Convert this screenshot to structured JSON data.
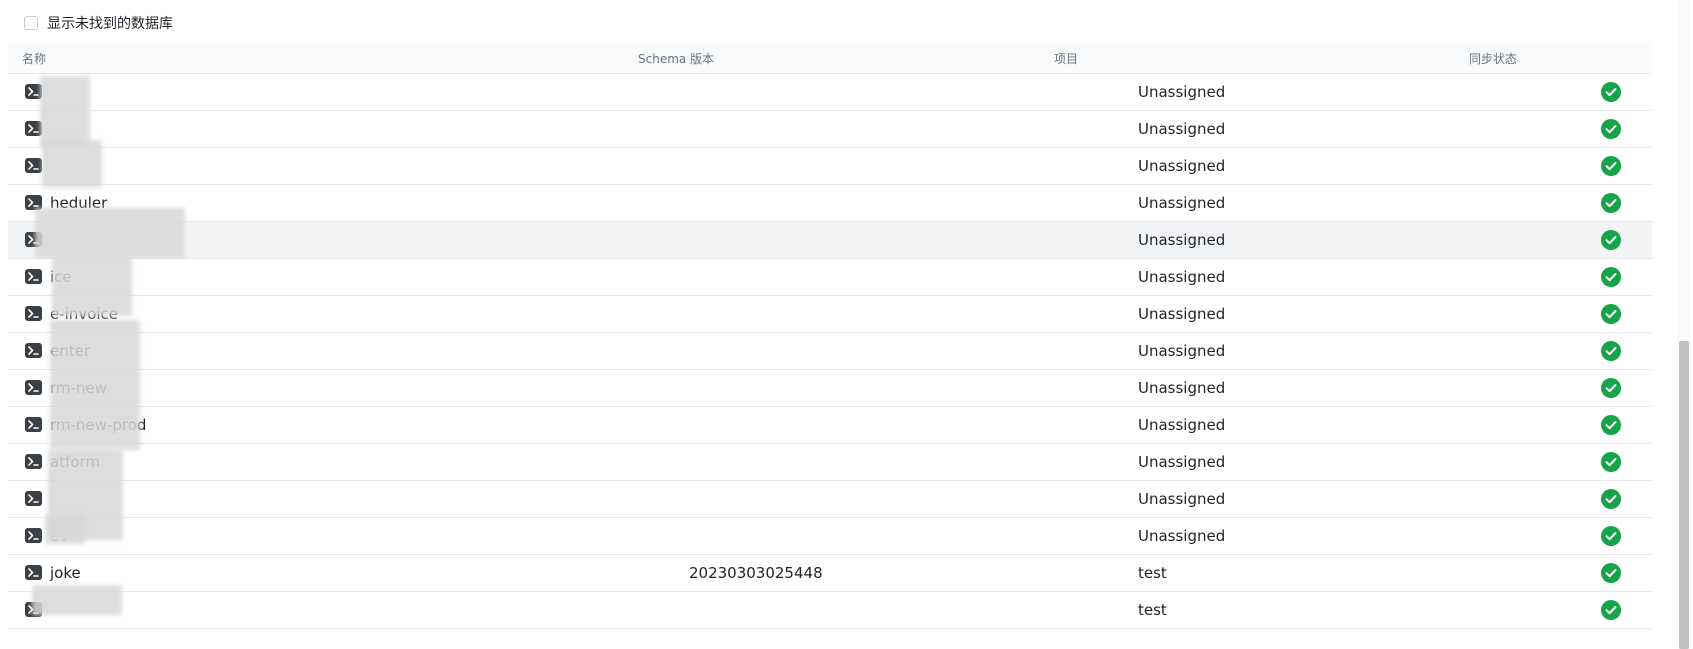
{
  "filter": {
    "show_missing_label": "显示未找到的数据库",
    "checked": false
  },
  "table": {
    "headers": {
      "name": "名称",
      "schema": "Schema 版本",
      "project": "项目",
      "sync": "同步状态"
    },
    "rows": [
      {
        "name": "",
        "schema": "",
        "project": "Unassigned",
        "status": "synced"
      },
      {
        "name": "",
        "schema": "",
        "project": "Unassigned",
        "status": "synced"
      },
      {
        "name": "",
        "schema": "",
        "project": "Unassigned",
        "status": "synced"
      },
      {
        "name": "heduler",
        "schema": "",
        "project": "Unassigned",
        "status": "synced"
      },
      {
        "name": "",
        "schema": "",
        "project": "Unassigned",
        "status": "synced"
      },
      {
        "name": "ice",
        "schema": "",
        "project": "Unassigned",
        "status": "synced"
      },
      {
        "name": "e-invoice",
        "schema": "",
        "project": "Unassigned",
        "status": "synced"
      },
      {
        "name": "enter",
        "schema": "",
        "project": "Unassigned",
        "status": "synced"
      },
      {
        "name": "rm-new",
        "schema": "",
        "project": "Unassigned",
        "status": "synced"
      },
      {
        "name": "rm-new-prod",
        "schema": "",
        "project": "Unassigned",
        "status": "synced"
      },
      {
        "name": "atform",
        "schema": "",
        "project": "Unassigned",
        "status": "synced"
      },
      {
        "name": "",
        "schema": "",
        "project": "Unassigned",
        "status": "synced"
      },
      {
        "name": "ev",
        "schema": "",
        "project": "Unassigned",
        "status": "synced"
      },
      {
        "name": "joke",
        "schema": "20230303025448",
        "project": "test",
        "status": "synced"
      },
      {
        "name": "",
        "schema": "",
        "project": "test",
        "status": "synced"
      }
    ]
  },
  "colors": {
    "status_green": "#16a34a",
    "icon_dark": "#3b4046"
  },
  "icons": {
    "row_icon": "terminal-icon",
    "status_icon": "check-circle-icon"
  }
}
